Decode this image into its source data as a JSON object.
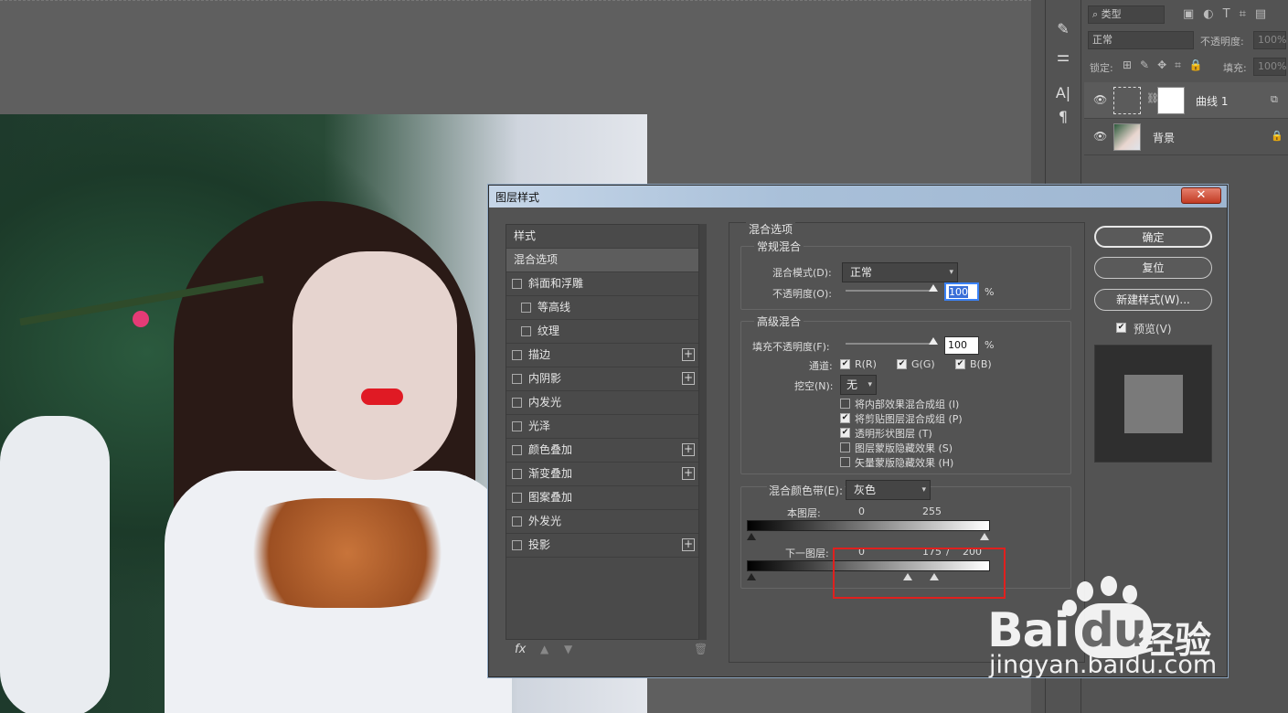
{
  "layers_panel": {
    "filter_kind": "类型",
    "blend_mode": "正常",
    "opacity_label": "不透明度:",
    "opacity_value": "100%",
    "lock_label": "锁定:",
    "fill_label": "填充:",
    "fill_value": "100%",
    "layers": [
      {
        "name": "曲线 1",
        "visible": true,
        "type": "adjustment"
      },
      {
        "name": "背景",
        "visible": true,
        "type": "image",
        "locked": true
      }
    ]
  },
  "dialog": {
    "title": "图层样式",
    "close_label": "✕",
    "sidebar": {
      "header": "样式",
      "items": [
        {
          "label": "混合选项",
          "selected": true,
          "checkbox": false,
          "plus": false
        },
        {
          "label": "斜面和浮雕",
          "checkbox": true,
          "plus": false
        },
        {
          "label": "等高线",
          "checkbox": true,
          "plus": false,
          "indent": true
        },
        {
          "label": "纹理",
          "checkbox": true,
          "plus": false,
          "indent": true
        },
        {
          "label": "描边",
          "checkbox": true,
          "plus": true
        },
        {
          "label": "内阴影",
          "checkbox": true,
          "plus": true
        },
        {
          "label": "内发光",
          "checkbox": true,
          "plus": false
        },
        {
          "label": "光泽",
          "checkbox": true,
          "plus": false
        },
        {
          "label": "颜色叠加",
          "checkbox": true,
          "plus": true
        },
        {
          "label": "渐变叠加",
          "checkbox": true,
          "plus": true
        },
        {
          "label": "图案叠加",
          "checkbox": true,
          "plus": false
        },
        {
          "label": "外发光",
          "checkbox": true,
          "plus": false
        },
        {
          "label": "投影",
          "checkbox": true,
          "plus": true
        }
      ],
      "fx_label": "fx"
    },
    "blend_options": {
      "section_title": "混合选项",
      "general_title": "常规混合",
      "blend_mode_label": "混合模式(D):",
      "blend_mode_value": "正常",
      "opacity_label": "不透明度(O):",
      "opacity_value": "100",
      "percent": "%",
      "advanced_title": "高级混合",
      "fill_opacity_label": "填充不透明度(F):",
      "fill_opacity_value": "100",
      "channels_label": "通道:",
      "channel_r": "R(R)",
      "channel_g": "G(G)",
      "channel_b": "B(B)",
      "knockout_label": "挖空(N):",
      "knockout_value": "无",
      "options": [
        {
          "label": "将内部效果混合成组 (I)",
          "checked": false
        },
        {
          "label": "将剪贴图层混合成组 (P)",
          "checked": true
        },
        {
          "label": "透明形状图层 (T)",
          "checked": true
        },
        {
          "label": "图层蒙版隐藏效果 (S)",
          "checked": false
        },
        {
          "label": "矢量蒙版隐藏效果 (H)",
          "checked": false
        }
      ],
      "blend_if_label": "混合颜色带(E):",
      "blend_if_value": "灰色",
      "this_layer_label": "本图层:",
      "this_layer_low": "0",
      "this_layer_high": "255",
      "underlying_label": "下一图层:",
      "underlying_low": "0",
      "underlying_high_a": "175",
      "underlying_sep": "/",
      "underlying_high_b": "200"
    },
    "buttons": {
      "ok": "确定",
      "reset": "复位",
      "new_style": "新建样式(W)...",
      "preview_label": "预览(V)"
    }
  },
  "watermark": {
    "brand_a": "Bai",
    "brand_b": "du",
    "brand_cn": "经验",
    "url": "jingyan.baidu.com"
  }
}
